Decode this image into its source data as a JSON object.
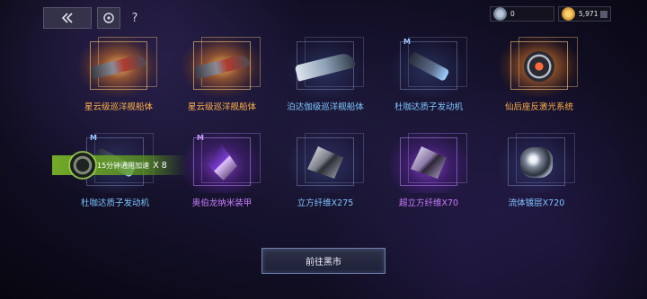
{
  "topbar": {
    "back_icon": "double-chevron-left-icon",
    "refresh_icon": "refresh-icon",
    "help_label": "?"
  },
  "resources": [
    {
      "icon": "silver-coin-icon",
      "value": "0"
    },
    {
      "icon": "gold-coin-icon",
      "value": "5,971"
    }
  ],
  "items": [
    {
      "label": "星云级巡洋舰船体",
      "rarity": "gold",
      "icon": "cruiser-hull-icon"
    },
    {
      "label": "星云级巡洋舰船体",
      "rarity": "gold",
      "icon": "cruiser-hull-icon"
    },
    {
      "label": "泊达伽级巡洋舰船体",
      "rarity": "blue",
      "icon": "cruiser-hull-icon"
    },
    {
      "label": "杜咖达质子发动机",
      "rarity": "blue",
      "badge": "M",
      "icon": "proton-engine-icon"
    },
    {
      "label": "仙后座反激光系统",
      "rarity": "gold",
      "icon": "anti-laser-system-icon"
    },
    {
      "label": "杜咖达质子发动机",
      "rarity": "blue",
      "badge": "M",
      "icon": "proton-engine-icon"
    },
    {
      "label": "奥伯龙纳米装甲",
      "rarity": "purple",
      "badge": "M",
      "icon": "nano-armor-icon"
    },
    {
      "label": "立方纤维X275",
      "rarity": "blue",
      "icon": "cubic-fiber-icon"
    },
    {
      "label": "超立方纤维X70",
      "rarity": "purple",
      "icon": "hypercubic-fiber-icon"
    },
    {
      "label": "流体镀层X720",
      "rarity": "blue",
      "icon": "fluid-coating-icon"
    }
  ],
  "speedup_toast": {
    "text": "15分钟通用加速",
    "count": "X 8",
    "icon": "speedup-disc-icon"
  },
  "cta": {
    "label": "前往黑市"
  }
}
